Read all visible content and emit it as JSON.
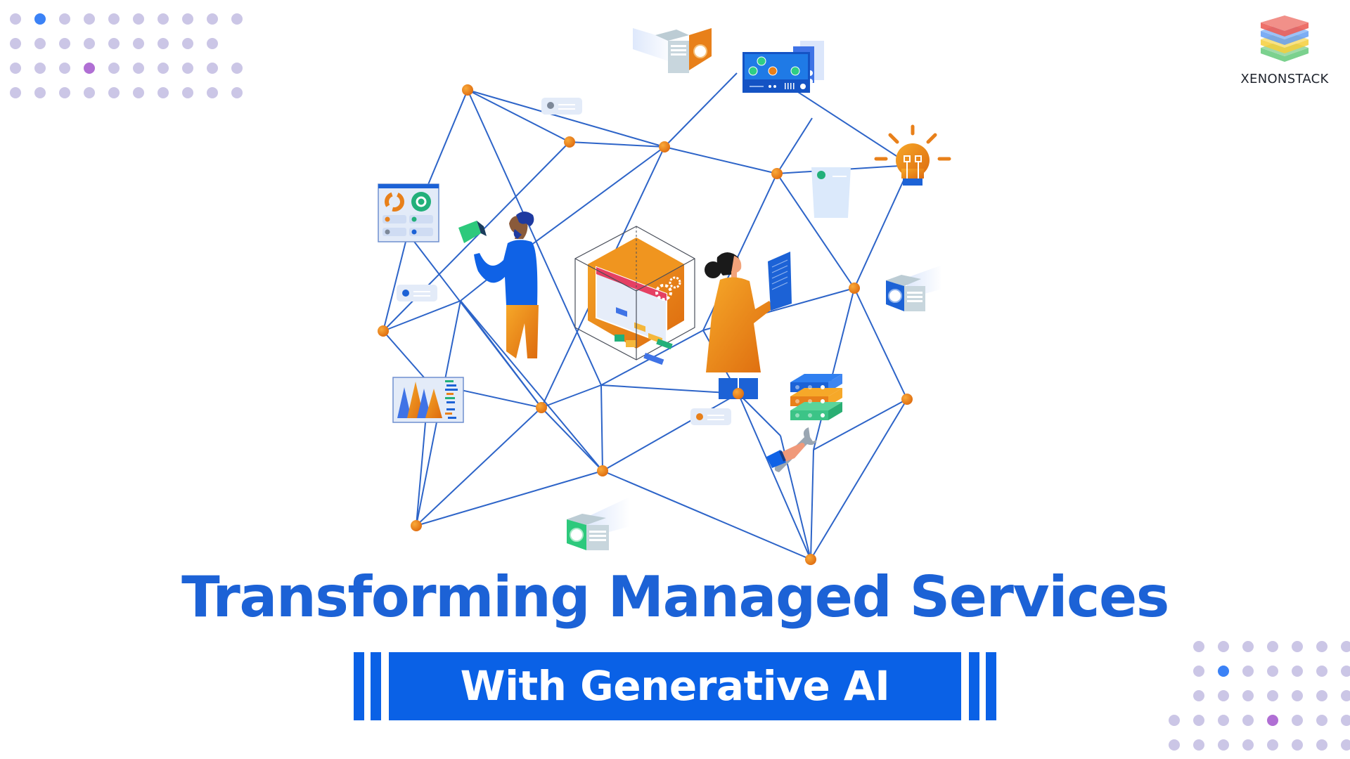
{
  "brand": {
    "name": "XENONSTACK",
    "logo_layer_colors": [
      "#e8453c",
      "#4a8ef0",
      "#f5c518",
      "#3dbb5a"
    ]
  },
  "headline": {
    "title": "Transforming Managed Services",
    "subtitle": "With Generative AI"
  },
  "colors": {
    "title": "#1c62d6",
    "banner": "#0a61e6",
    "network_line": "#2d64c8",
    "node": "#e8801a",
    "dot": "#cbc6e6",
    "dot_accent_blue": "#3b82f6",
    "dot_accent_purple": "#b06fd4"
  },
  "illustration": {
    "icons": [
      "dashboard-window-icon",
      "server-rack-icon",
      "lightbulb-icon",
      "isometric-cube-app-icon",
      "database-stack-icon",
      "wrench-hand-icon",
      "area-chart-panel-icon",
      "projector-box-icon",
      "message-chip-icon",
      "person-man-icon",
      "person-woman-icon"
    ]
  }
}
